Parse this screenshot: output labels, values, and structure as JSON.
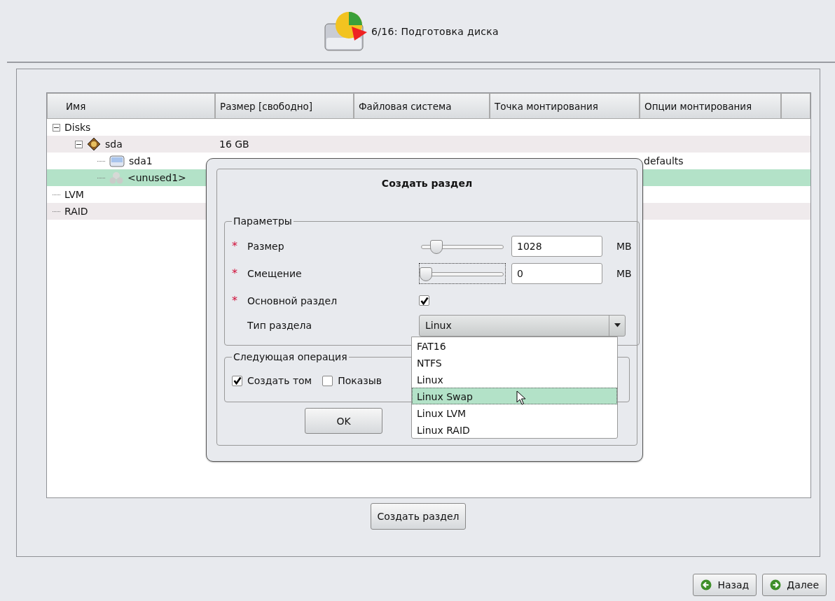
{
  "header": {
    "title": "6/16: Подготовка диска"
  },
  "tree": {
    "columns": [
      "Имя",
      "Размер [свободно]",
      "Файловая система",
      "Точка монтирования",
      "Опции монтирования"
    ],
    "rows": [
      {
        "name": "Disks",
        "expanded": true,
        "selected": false,
        "children": [
          {
            "name": "sda",
            "kind": "disk",
            "expanded": true,
            "selected": false,
            "size": "16 GB",
            "children": [
              {
                "name": "sda1",
                "kind": "partition",
                "selected": false,
                "options": "defaults"
              },
              {
                "name": "<unused1>",
                "kind": "free",
                "selected": true
              }
            ]
          }
        ]
      },
      {
        "name": "LVM",
        "selected": false
      },
      {
        "name": "RAID",
        "selected": false
      }
    ]
  },
  "create_button": "Создать раздел",
  "dialog": {
    "title": "Создать раздел",
    "params_legend": "Параметры",
    "fields": [
      {
        "kind": "slider",
        "marker": "*",
        "label": "Размер",
        "level": 0.12,
        "value": "1028",
        "unit": "MB",
        "focused": false
      },
      {
        "kind": "slider",
        "marker": "*",
        "label": "Смещение",
        "level": 0,
        "value": "0",
        "unit": "MB",
        "focused": true
      },
      {
        "kind": "checkbox",
        "marker": "*",
        "label": "Основной раздел",
        "checked": true
      },
      {
        "kind": "combo",
        "label": "Тип раздела",
        "value": "Linux"
      }
    ],
    "type_options": [
      {
        "label": "FAT16",
        "selected": false
      },
      {
        "label": "NTFS",
        "selected": false
      },
      {
        "label": "Linux",
        "selected": false
      },
      {
        "label": "Linux Swap",
        "selected": true
      },
      {
        "label": "Linux LVM",
        "selected": false
      },
      {
        "label": "Linux RAID",
        "selected": false
      }
    ],
    "next_legend": "Следующая операция",
    "next_options": [
      {
        "label": "Создать том",
        "checked": true
      },
      {
        "label": "Показыв",
        "checked": false
      }
    ],
    "ok_button": "OK"
  },
  "nav": [
    {
      "label": "Назад",
      "kind": "back"
    },
    {
      "label": "Далее",
      "kind": "next"
    }
  ]
}
